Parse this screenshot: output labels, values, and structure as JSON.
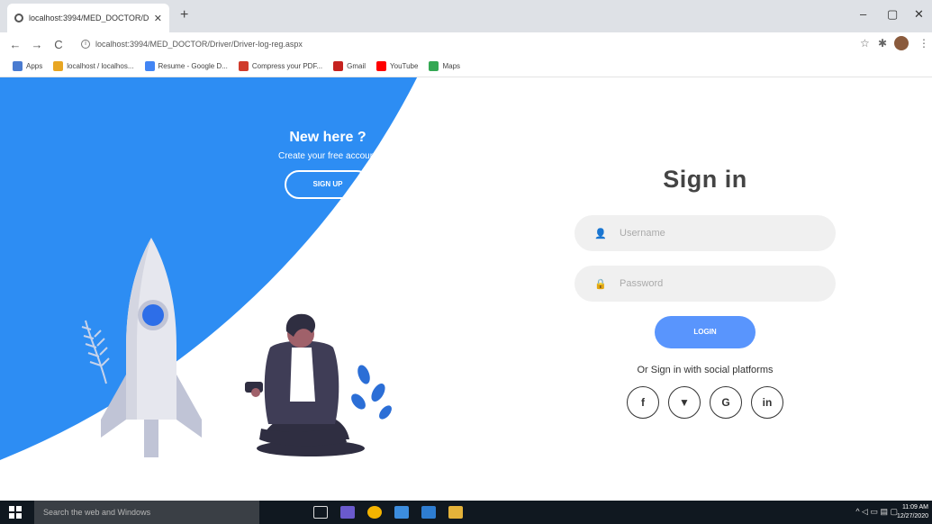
{
  "browser": {
    "tab_title": "localhost:3994/MED_DOCTOR/D...",
    "url": "localhost:3994/MED_DOCTOR/Driver/Driver-log-reg.aspx",
    "bookmarks": [
      {
        "label": "Apps",
        "color": "#4a7bd0"
      },
      {
        "label": "localhost / localhos...",
        "color": "#e8a623"
      },
      {
        "label": "Resume - Google D...",
        "color": "#4285f4"
      },
      {
        "label": "Compress your PDF...",
        "color": "#d03b2b"
      },
      {
        "label": "Gmail",
        "color": "#c5221f"
      },
      {
        "label": "YouTube",
        "color": "#ff0000"
      },
      {
        "label": "Maps",
        "color": "#34a853"
      }
    ]
  },
  "panel": {
    "title": "New here ?",
    "subtitle": "Create your free account",
    "signup_label": "SIGN UP"
  },
  "signin": {
    "title": "Sign in",
    "username_placeholder": "Username",
    "password_placeholder": "Password",
    "login_label": "LOGIN",
    "social_text": "Or Sign in with social platforms",
    "socials": [
      "f",
      "▼",
      "G",
      "in"
    ]
  },
  "taskbar": {
    "search_placeholder": "Search the web and Windows",
    "time": "11:09 AM",
    "date": "12/27/2020"
  },
  "colors": {
    "brand_blue": "#2d8df3",
    "button_blue": "#5995fd"
  }
}
